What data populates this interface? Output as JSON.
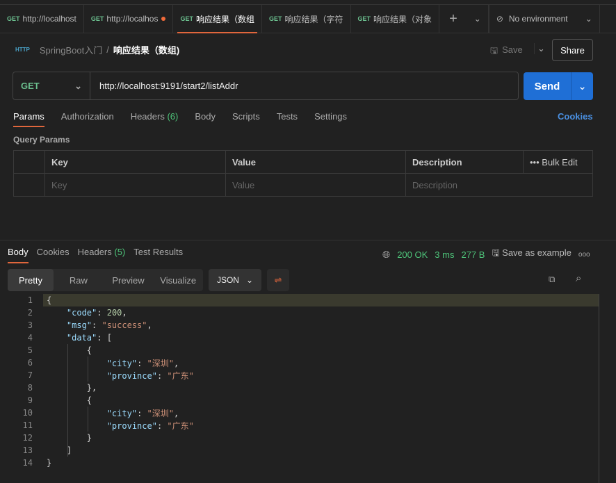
{
  "tabs": [
    {
      "method": "GET",
      "label": "http://localhost",
      "active": false,
      "dirty": false
    },
    {
      "method": "GET",
      "label": "http://localhos",
      "active": false,
      "dirty": true
    },
    {
      "method": "GET",
      "label": "响应结果（数组",
      "active": true,
      "dirty": false
    },
    {
      "method": "GET",
      "label": "响应结果（字符",
      "active": false,
      "dirty": false
    },
    {
      "method": "GET",
      "label": "响应结果（对象",
      "active": false,
      "dirty": false
    }
  ],
  "environment": "No environment",
  "breadcrumb": {
    "icon": "HTTP",
    "collection": "SpringBoot入门",
    "sep": "/",
    "request": "响应结果（数组)"
  },
  "save_label": "Save",
  "share_label": "Share",
  "request": {
    "method": "GET",
    "url": "http://localhost:9191/start2/listAddr",
    "send_label": "Send"
  },
  "param_tabs": [
    "Params",
    "Authorization",
    "Headers",
    "Body",
    "Scripts",
    "Tests",
    "Settings"
  ],
  "headers_count": "(6)",
  "cookies_label": "Cookies",
  "query_params_title": "Query Params",
  "table": {
    "headers": [
      "Key",
      "Value",
      "Description"
    ],
    "bulk_edit": "Bulk Edit",
    "placeholders": [
      "Key",
      "Value",
      "Description"
    ]
  },
  "response": {
    "tabs": [
      "Body",
      "Cookies",
      "Headers",
      "Test Results"
    ],
    "headers_count": "(5)",
    "status": "200 OK",
    "time": "3 ms",
    "size": "277 B",
    "save_example": "Save as example",
    "view_modes": [
      "Pretty",
      "Raw",
      "Preview",
      "Visualize"
    ],
    "format": "JSON",
    "lines": [
      [
        [
          "p",
          "{"
        ]
      ],
      [
        [
          "p",
          "    "
        ],
        [
          "k",
          "\"code\""
        ],
        [
          "p",
          ": "
        ],
        [
          "n",
          "200"
        ],
        [
          "p",
          ","
        ]
      ],
      [
        [
          "p",
          "    "
        ],
        [
          "k",
          "\"msg\""
        ],
        [
          "p",
          ": "
        ],
        [
          "s",
          "\"success\""
        ],
        [
          "p",
          ","
        ]
      ],
      [
        [
          "p",
          "    "
        ],
        [
          "k",
          "\"data\""
        ],
        [
          "p",
          ": ["
        ]
      ],
      [
        [
          "p",
          "        {"
        ]
      ],
      [
        [
          "p",
          "            "
        ],
        [
          "k",
          "\"city\""
        ],
        [
          "p",
          ": "
        ],
        [
          "s",
          "\"深圳\""
        ],
        [
          "p",
          ","
        ]
      ],
      [
        [
          "p",
          "            "
        ],
        [
          "k",
          "\"province\""
        ],
        [
          "p",
          ": "
        ],
        [
          "s",
          "\"广东\""
        ]
      ],
      [
        [
          "p",
          "        },"
        ]
      ],
      [
        [
          "p",
          "        {"
        ]
      ],
      [
        [
          "p",
          "            "
        ],
        [
          "k",
          "\"city\""
        ],
        [
          "p",
          ": "
        ],
        [
          "s",
          "\"深圳\""
        ],
        [
          "p",
          ","
        ]
      ],
      [
        [
          "p",
          "            "
        ],
        [
          "k",
          "\"province\""
        ],
        [
          "p",
          ": "
        ],
        [
          "s",
          "\"广东\""
        ]
      ],
      [
        [
          "p",
          "        }"
        ]
      ],
      [
        [
          "p",
          "    ]"
        ]
      ],
      [
        [
          "p",
          "}"
        ]
      ]
    ]
  }
}
